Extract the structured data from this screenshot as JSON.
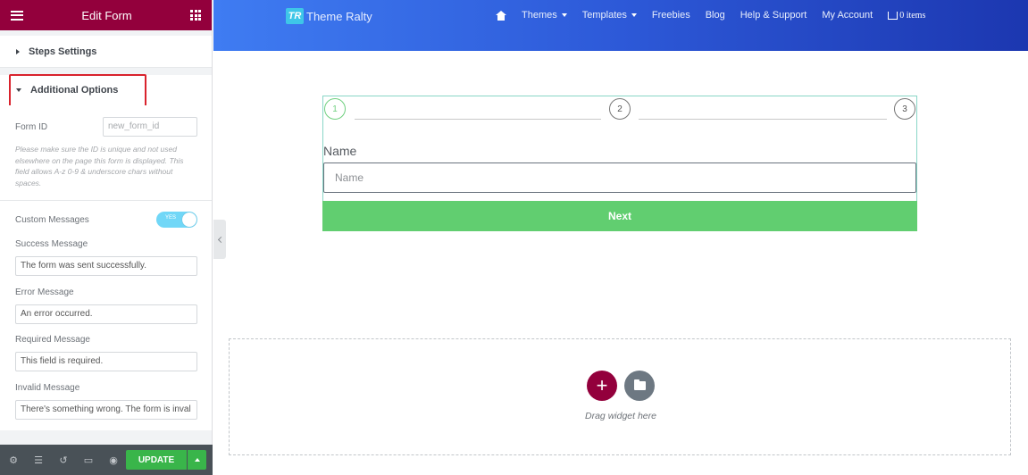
{
  "panel": {
    "title": "Edit Form",
    "sections": {
      "steps_settings": "Steps Settings",
      "additional_options": "Additional Options"
    },
    "form_id": {
      "label": "Form ID",
      "placeholder": "new_form_id",
      "help": "Please make sure the ID is unique and not used elsewhere on the page this form is displayed. This field allows A-z 0-9 & underscore chars without spaces."
    },
    "custom_messages": {
      "label": "Custom Messages",
      "toggle_text": "YES",
      "enabled": true
    },
    "messages": [
      {
        "label": "Success Message",
        "value": "The form was sent successfully."
      },
      {
        "label": "Error Message",
        "value": "An error occurred."
      },
      {
        "label": "Required Message",
        "value": "This field is required."
      },
      {
        "label": "Invalid Message",
        "value": "There's something wrong. The form is inval"
      }
    ],
    "footer": {
      "update_label": "UPDATE"
    }
  },
  "site": {
    "logo_mark": "TR",
    "logo_name": "Theme Ralty",
    "nav": [
      "Themes",
      "Templates",
      "Freebies",
      "Blog",
      "Help & Support",
      "My Account"
    ],
    "cart": "0 items"
  },
  "form": {
    "steps": [
      "1",
      "2",
      "3"
    ],
    "name_label": "Name",
    "name_placeholder": "Name",
    "next_label": "Next"
  },
  "drop_zone": {
    "text": "Drag widget here"
  },
  "colors": {
    "brand": "#93003c",
    "update_green": "#39b54a",
    "next_green": "#61ce70",
    "header_gradient_start": "#3f7cf2",
    "header_gradient_end": "#1c37b0"
  }
}
